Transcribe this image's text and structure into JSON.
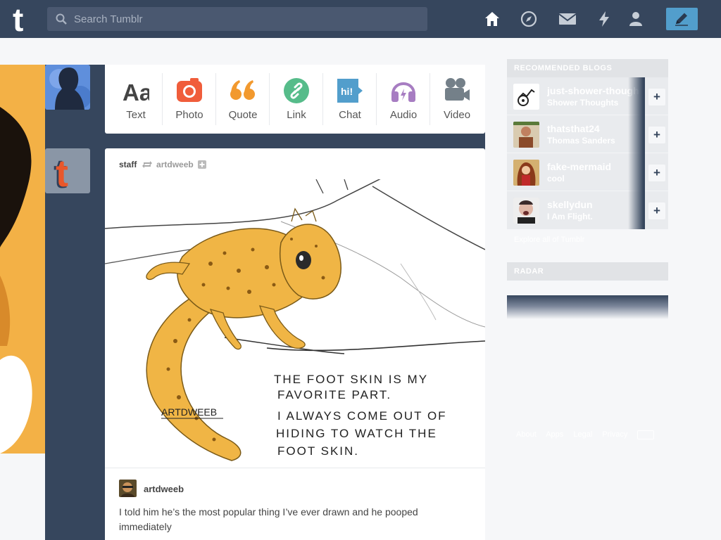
{
  "search": {
    "placeholder": "Search Tumblr"
  },
  "nav": {
    "icons": [
      "home-icon",
      "explore-icon",
      "inbox-icon",
      "activity-icon",
      "account-icon"
    ],
    "compose_icon": "pencil-icon"
  },
  "post_types": [
    {
      "label": "Text",
      "icon": "text-icon",
      "color": "#444444"
    },
    {
      "label": "Photo",
      "icon": "camera-icon",
      "color": "#f05d3b"
    },
    {
      "label": "Quote",
      "icon": "quote-icon",
      "color": "#f2992e"
    },
    {
      "label": "Link",
      "icon": "link-icon",
      "color": "#56bc8a"
    },
    {
      "label": "Chat",
      "icon": "chat-icon",
      "color": "#529ecc"
    },
    {
      "label": "Audio",
      "icon": "headphones-icon",
      "color": "#a77dc2"
    },
    {
      "label": "Video",
      "icon": "video-camera-icon",
      "color": "#748089"
    }
  ],
  "post": {
    "author": "staff",
    "source": "artdweeb",
    "artwork_text": {
      "signature": "ARTDWEEB",
      "lines": [
        "THE FOOT SKIN IS MY",
        "FAVORITE PART.",
        "I ALWAYS COME OUT OF",
        "HIDING TO WATCH THE",
        "FOOT SKIN."
      ]
    },
    "commenter": "artdweeb",
    "comment": "I told him he’s the most popular thing I’ve ever drawn and he pooped immediately"
  },
  "sidebar": {
    "recommended_title": "RECOMMENDED BLOGS",
    "blogs": [
      {
        "name": "just-shower-thoughts",
        "title": "Shower Thoughts"
      },
      {
        "name": "thatsthat24",
        "title": "Thomas Sanders"
      },
      {
        "name": "fake-mermaid",
        "title": "cool"
      },
      {
        "name": "skellydun",
        "title": "I Am Flight."
      }
    ],
    "follow_label": "+",
    "explore_link": "Explore all of Tumblr",
    "radar_title": "RADAR",
    "footer": [
      "About",
      "Apps",
      "Legal",
      "Privacy"
    ]
  },
  "colors": {
    "bg": "#36465d",
    "accent": "#529ecc",
    "light": "#f6f7f9"
  }
}
